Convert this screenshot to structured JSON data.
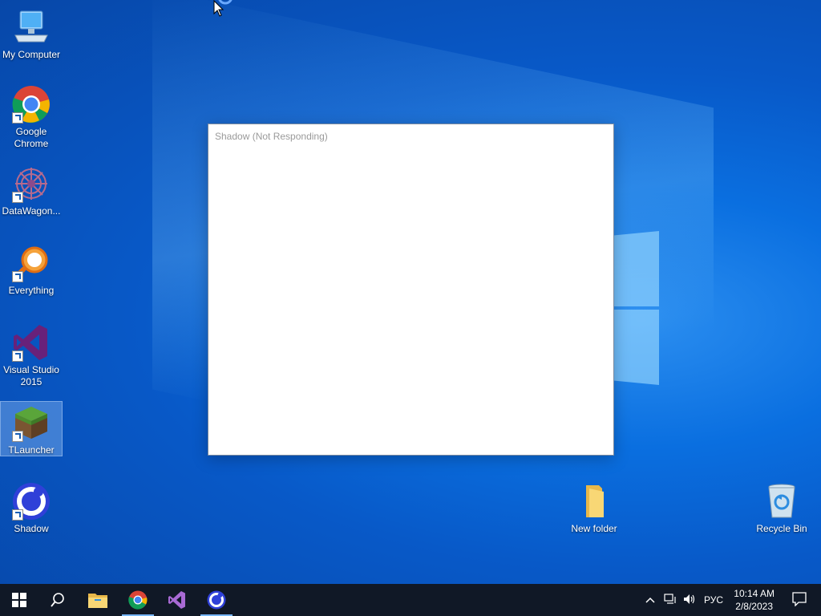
{
  "desktop": {
    "icons": [
      {
        "label": "My Computer"
      },
      {
        "label": "Google Chrome"
      },
      {
        "label": "DataWagon..."
      },
      {
        "label": "Everything"
      },
      {
        "label": "Visual Studio 2015"
      },
      {
        "label": "TLauncher"
      },
      {
        "label": "Shadow"
      },
      {
        "label": "New folder"
      },
      {
        "label": "Recycle Bin"
      }
    ]
  },
  "window": {
    "title": "Shadow (Not Responding)"
  },
  "taskbar": {
    "pinned": [
      "start-icon",
      "search-icon",
      "file-explorer-icon",
      "chrome-icon",
      "visual-studio-icon",
      "shadow-icon"
    ],
    "language": "РУС",
    "time": "10:14 AM",
    "date": "2/8/2023"
  },
  "colors": {
    "desktop_blue": "#0a6fe0",
    "taskbar": "#101826",
    "vs_purple": "#68217a"
  }
}
